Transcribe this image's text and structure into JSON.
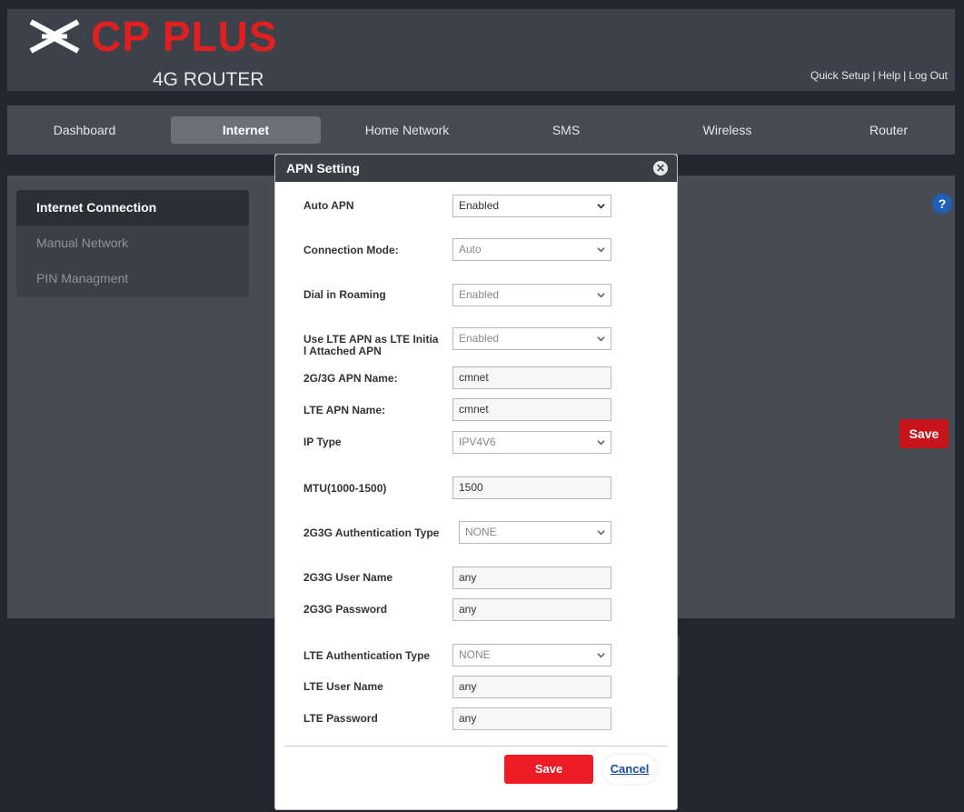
{
  "brand": {
    "logo_text": "CP PLUS",
    "subtitle": "4G ROUTER",
    "accent_color": "#e02020"
  },
  "top_links": {
    "quick_setup": "Quick Setup",
    "help": "Help",
    "logout": "Log Out",
    "separator": "|"
  },
  "nav": {
    "items": [
      "Dashboard",
      "Internet",
      "Home Network",
      "SMS",
      "Wireless",
      "Router"
    ],
    "active": "Internet"
  },
  "sidebar": {
    "items": [
      "Internet Connection",
      "Manual Network",
      "PIN Managment"
    ],
    "active": "Internet Connection"
  },
  "main": {
    "help_symbol": "?",
    "save_label": "Save"
  },
  "modal": {
    "title": "APN Setting",
    "close_symbol": "✕",
    "fields": {
      "auto_apn": {
        "label": "Auto APN",
        "value": "Enabled"
      },
      "connection_mode": {
        "label": "Connection Mode:",
        "value": "Auto"
      },
      "dial_roaming": {
        "label": "Dial in Roaming",
        "value": "Enabled"
      },
      "lte_initial_apn": {
        "label_line1": "Use LTE APN as LTE Initia",
        "label_line2": "l Attached APN",
        "value": "Enabled"
      },
      "apn_2g3g": {
        "label": "2G/3G APN Name:",
        "value": "cmnet"
      },
      "apn_lte": {
        "label": "LTE APN Name:",
        "value": "cmnet"
      },
      "ip_type": {
        "label": "IP Type",
        "value": "IPV4V6"
      },
      "mtu": {
        "label": "MTU(1000-1500)",
        "value": "1500"
      },
      "auth_2g3g": {
        "label": "2G3G Authentication Type",
        "value": "NONE"
      },
      "user_2g3g": {
        "label": "2G3G User Name",
        "value": "any"
      },
      "pass_2g3g": {
        "label": "2G3G Password",
        "value": "any"
      },
      "auth_lte": {
        "label": "LTE Authentication Type",
        "value": "NONE"
      },
      "user_lte": {
        "label": "LTE User Name",
        "value": "any"
      },
      "pass_lte": {
        "label": "LTE Password",
        "value": "any"
      }
    },
    "save_label": "Save",
    "cancel_label": "Cancel"
  }
}
